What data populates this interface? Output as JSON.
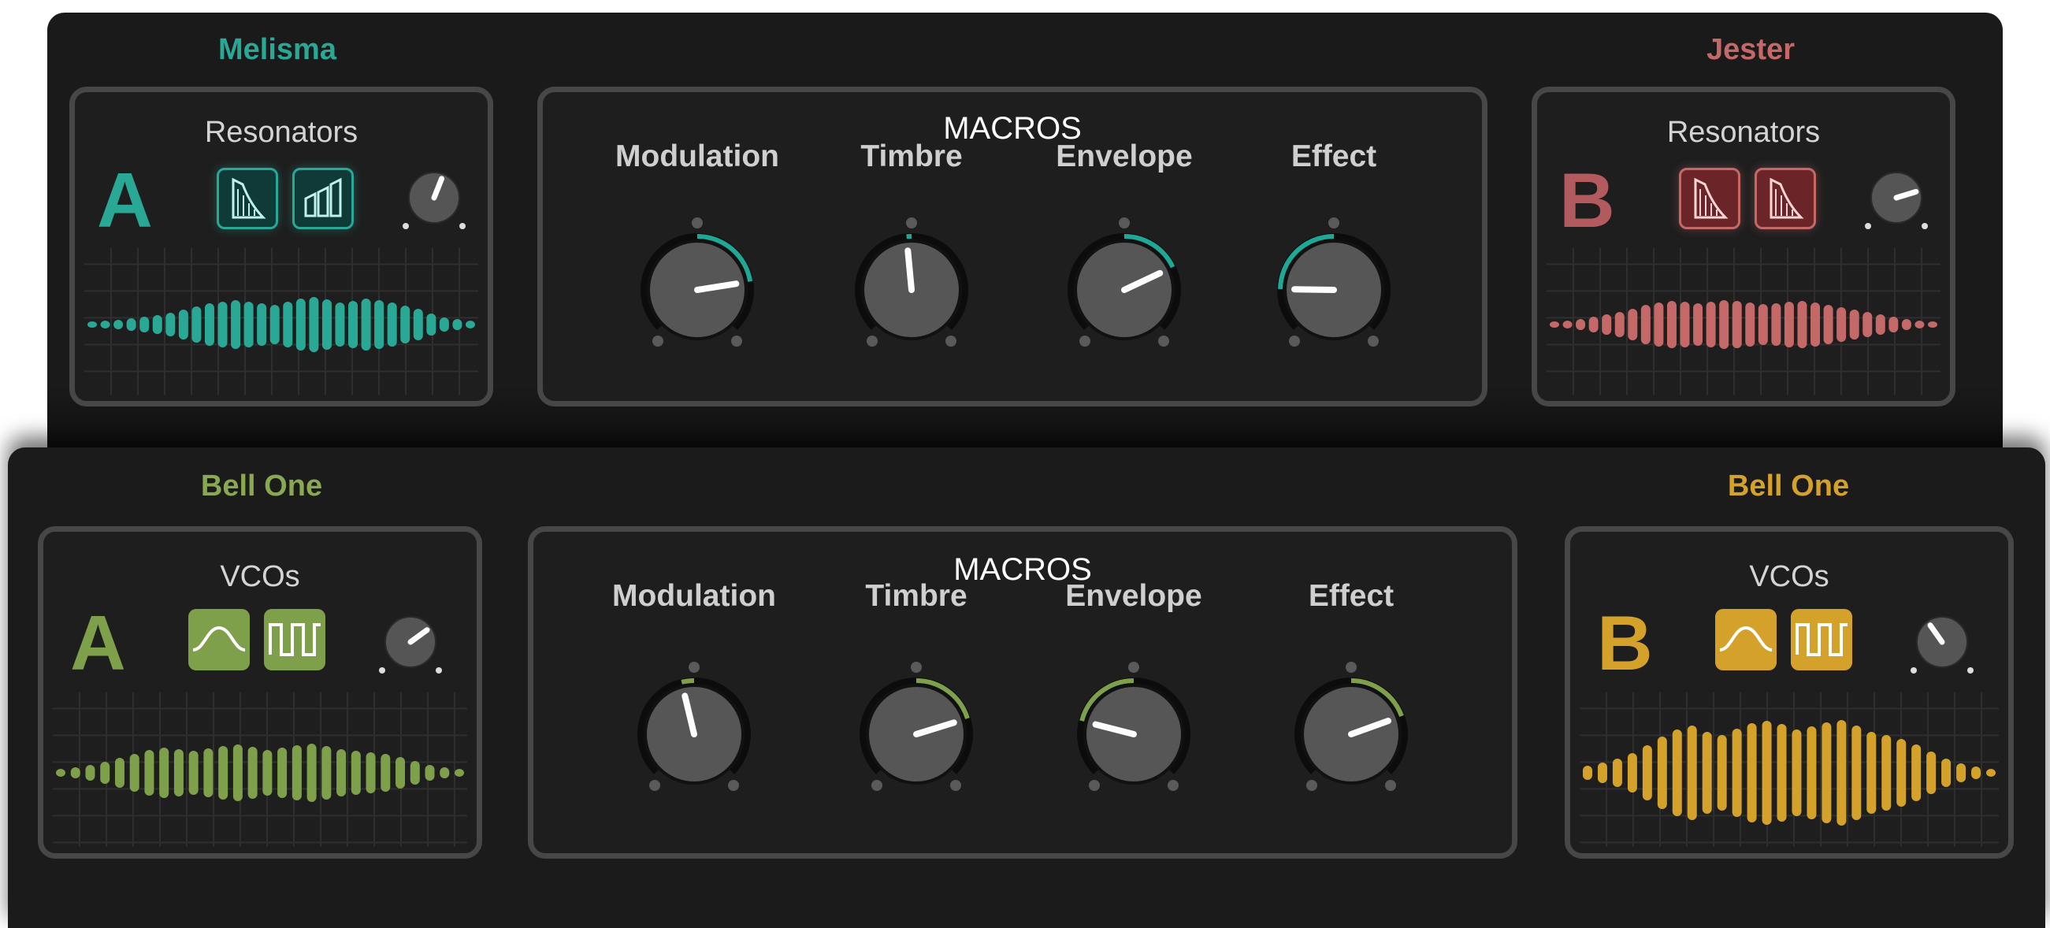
{
  "top": {
    "slot_a": {
      "preset_name": "Melisma",
      "module_title": "Resonators",
      "letter": "A",
      "color": "#2aa896",
      "bg_color": "#0f3a37",
      "sources": [
        "harp-icon",
        "tubes-icon"
      ],
      "mix_level": 0.58,
      "wave_heights": [
        8,
        10,
        12,
        16,
        20,
        24,
        30,
        38,
        46,
        54,
        58,
        62,
        58,
        54,
        50,
        58,
        66,
        70,
        64,
        56,
        60,
        66,
        62,
        56,
        48,
        40,
        28,
        18,
        14,
        10
      ]
    },
    "macros": {
      "title": "MACROS",
      "accent": "#1fa896",
      "items": [
        {
          "label": "Modulation",
          "value": 0.8
        },
        {
          "label": "Timbre",
          "value": 0.48
        },
        {
          "label": "Envelope",
          "value": 0.74
        },
        {
          "label": "Effect",
          "value": 0.17
        }
      ]
    },
    "slot_b": {
      "preset_name": "Jester",
      "module_title": "Resonators",
      "letter": "B",
      "color": "#c46868",
      "bg_color": "#5b2023",
      "sources": [
        "harp-icon",
        "harp-icon"
      ],
      "mix_level": 0.77,
      "wave_heights": [
        8,
        10,
        14,
        20,
        26,
        32,
        40,
        50,
        56,
        60,
        58,
        54,
        58,
        62,
        60,
        56,
        52,
        54,
        58,
        60,
        56,
        50,
        44,
        38,
        32,
        26,
        20,
        14,
        10,
        8
      ]
    }
  },
  "bottom": {
    "slot_a": {
      "preset_name": "Bell One",
      "module_title": "VCOs",
      "letter": "A",
      "color": "#7ea04a",
      "bg_color": "#7ea04a",
      "sources": [
        "sine-wave-icon",
        "square-wave-icon"
      ],
      "mix_level": 0.7,
      "wave_heights": [
        10,
        14,
        20,
        28,
        38,
        48,
        58,
        64,
        60,
        56,
        62,
        68,
        72,
        66,
        58,
        64,
        70,
        74,
        68,
        60,
        56,
        52,
        48,
        40,
        30,
        20,
        14,
        10
      ]
    },
    "macros": {
      "title": "MACROS",
      "accent": "#7ea04a",
      "items": [
        {
          "label": "Modulation",
          "value": 0.45
        },
        {
          "label": "Timbre",
          "value": 0.77
        },
        {
          "label": "Envelope",
          "value": 0.22
        },
        {
          "label": "Effect",
          "value": 0.76
        }
      ]
    },
    "slot_b": {
      "preset_name": "Bell One",
      "module_title": "VCOs",
      "letter": "B",
      "color": "#d4a22a",
      "bg_color": "#d4a22a",
      "sources": [
        "sine-wave-icon",
        "square-wave-icon"
      ],
      "mix_level": 0.37,
      "wave_heights": [
        18,
        26,
        36,
        50,
        70,
        92,
        110,
        120,
        104,
        96,
        112,
        126,
        132,
        124,
        110,
        118,
        128,
        134,
        120,
        104,
        96,
        86,
        72,
        54,
        36,
        24,
        16,
        10
      ]
    }
  }
}
